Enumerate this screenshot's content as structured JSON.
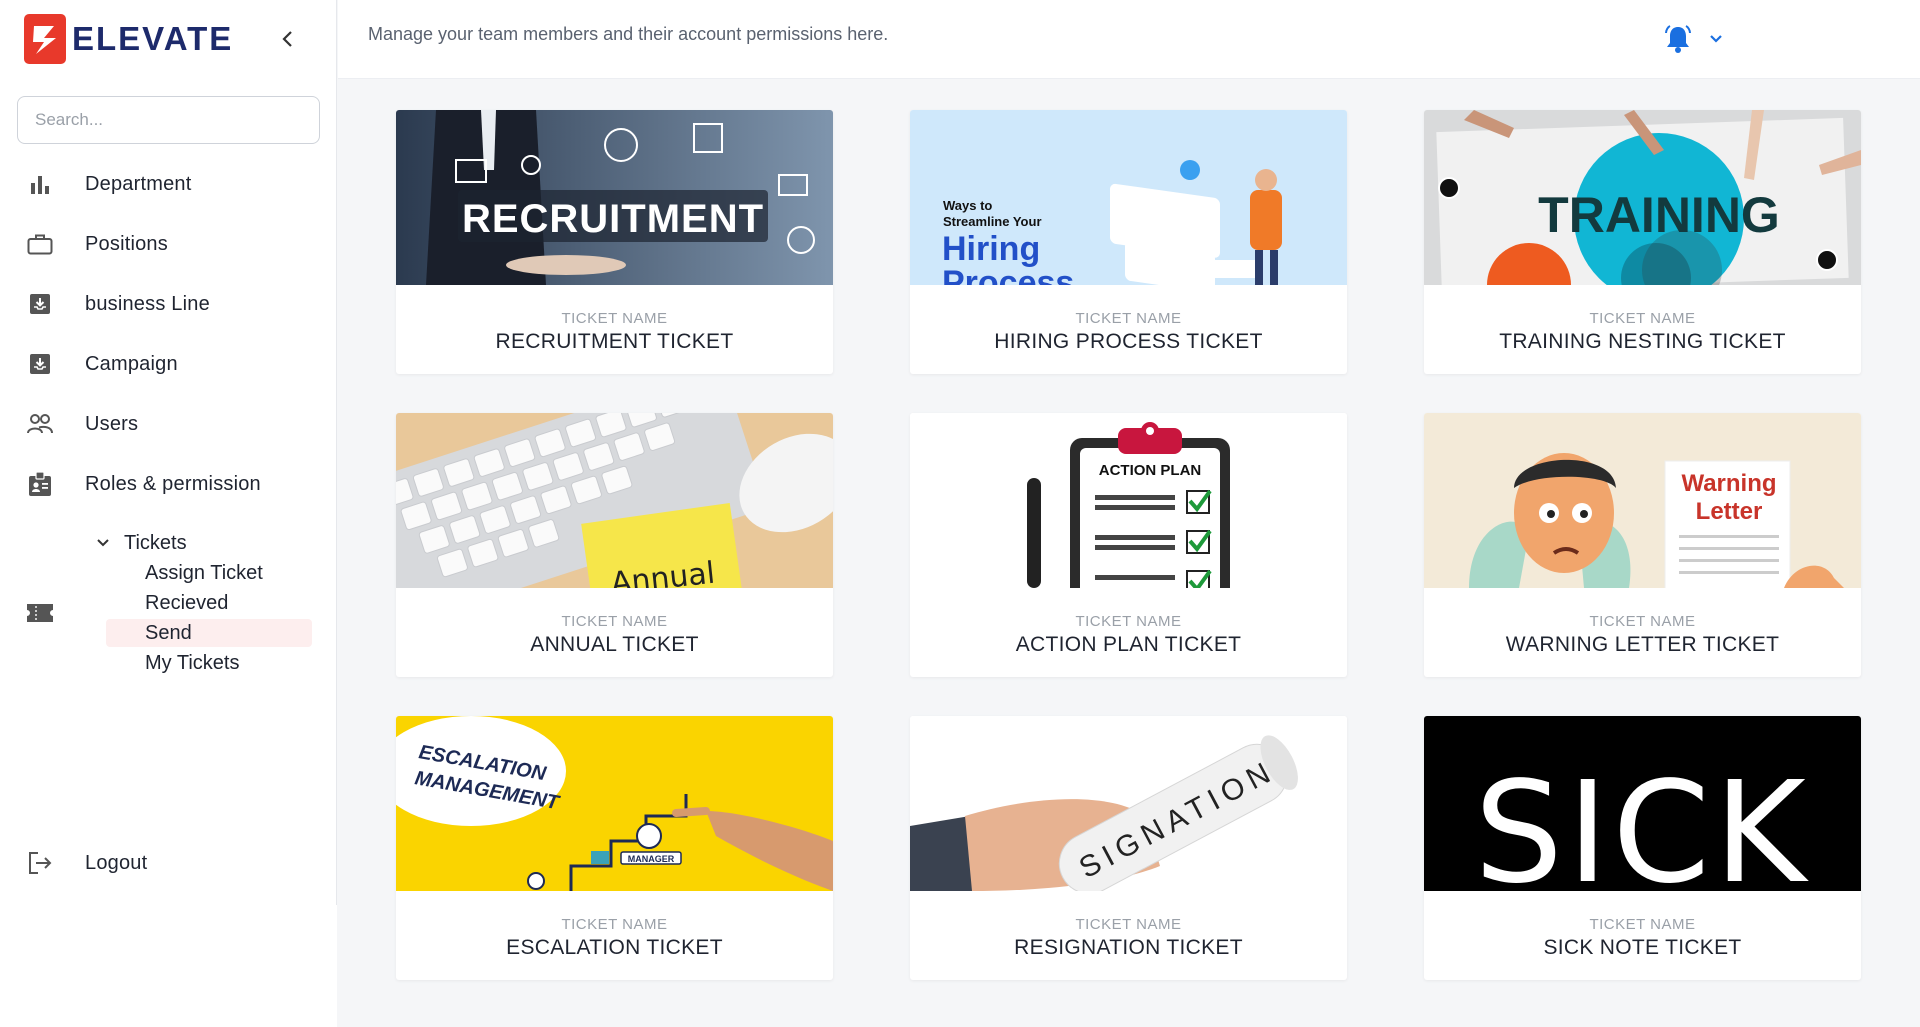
{
  "app": {
    "brand": "ELEVATE"
  },
  "search": {
    "placeholder": "Search..."
  },
  "nav": {
    "items": [
      {
        "label": "Department",
        "icon": "bar-chart-icon"
      },
      {
        "label": "Positions",
        "icon": "briefcase-icon"
      },
      {
        "label": "business Line",
        "icon": "inbox-download-icon"
      },
      {
        "label": "Campaign",
        "icon": "inbox-download-icon"
      },
      {
        "label": "Users",
        "icon": "users-icon"
      },
      {
        "label": "Roles & permission",
        "icon": "id-badge-icon"
      }
    ],
    "tickets": {
      "label": "Tickets",
      "icon": "ticket-icon",
      "sub": [
        "Assign Ticket",
        "Recieved",
        "Send",
        "My Tickets"
      ],
      "active": "Send"
    },
    "logout": "Logout"
  },
  "header": {
    "subtitle": "Manage your team members and their account permissions here."
  },
  "cards": [
    {
      "caption": "TICKET NAME",
      "title": "RECRUITMENT TICKET",
      "image_text": "RECRUITMENT"
    },
    {
      "caption": "TICKET NAME",
      "title": "HIRING PROCESS TICKET",
      "image_text": "Ways to Streamline Your Hiring Process"
    },
    {
      "caption": "TICKET NAME",
      "title": "TRAINING NESTING TICKET",
      "image_text": "TRAINING"
    },
    {
      "caption": "TICKET NAME",
      "title": "ANNUAL TICKET",
      "image_text": "Annual"
    },
    {
      "caption": "TICKET NAME",
      "title": "ACTION PLAN TICKET",
      "image_text": "ACTION PLAN"
    },
    {
      "caption": "TICKET NAME",
      "title": "WARNING LETTER TICKET",
      "image_text": "Warning Letter"
    },
    {
      "caption": "TICKET NAME",
      "title": "ESCALATION TICKET",
      "image_text": "ESCALATION MANAGEMENT"
    },
    {
      "caption": "TICKET NAME",
      "title": "RESIGNATION TICKET",
      "image_text": "SIGNATION"
    },
    {
      "caption": "TICKET NAME",
      "title": "SICK NOTE TICKET",
      "image_text": "SICK"
    }
  ],
  "colors": {
    "accent": "#e8392b",
    "brand": "#1d2a6b",
    "active_bg": "#fdeeee",
    "bell": "#1a6fe0"
  }
}
